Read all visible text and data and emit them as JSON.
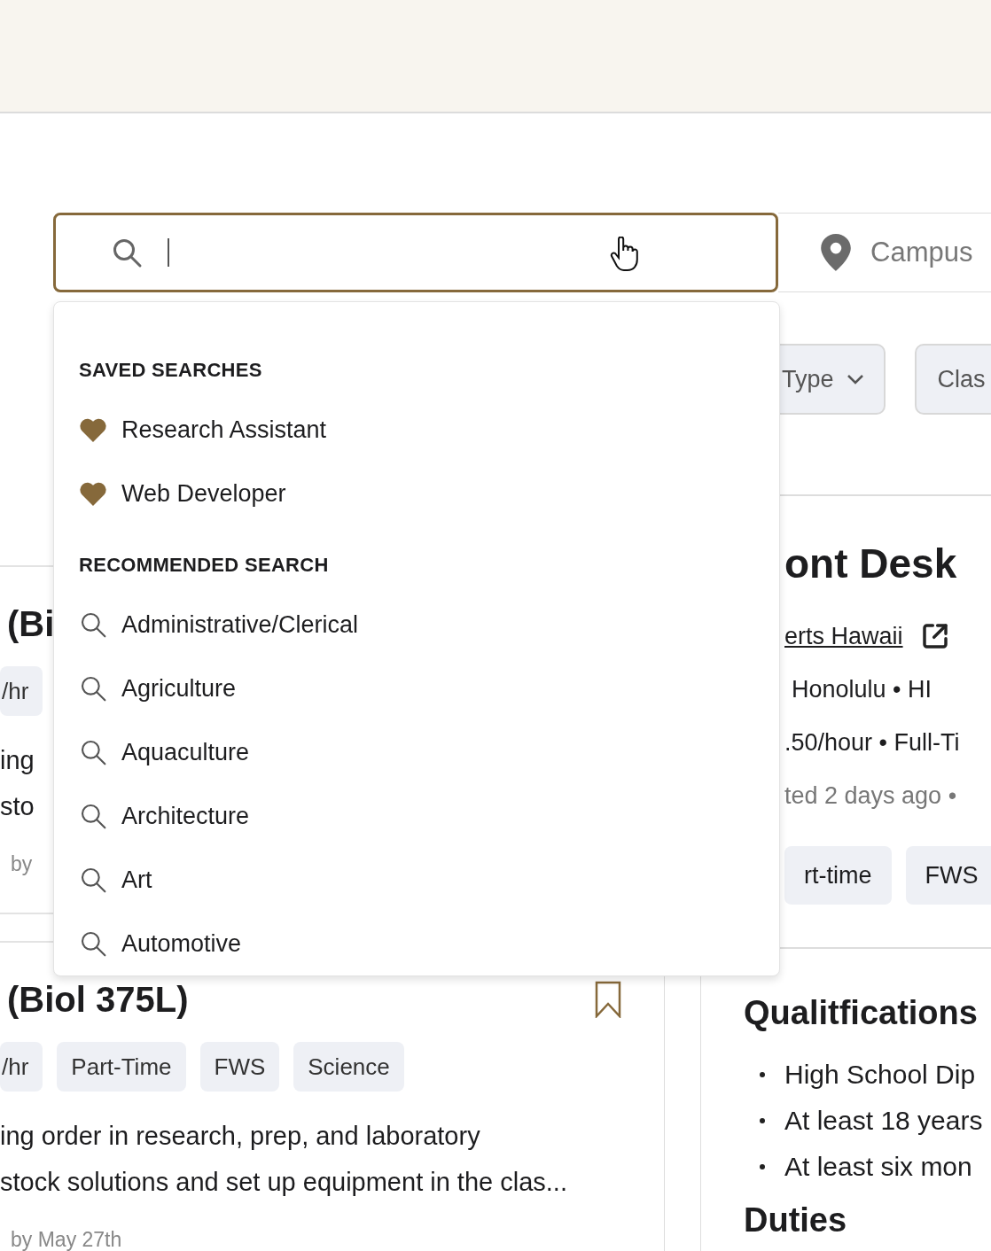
{
  "search": {
    "focused": true
  },
  "location": {
    "placeholder": "Campus"
  },
  "filters": [
    {
      "label": "Type",
      "kind": "dropdown"
    },
    {
      "label": "Clas",
      "kind": "plain"
    }
  ],
  "dropdown": {
    "sections": [
      {
        "heading": "SAVED SEARCHES",
        "kind": "saved",
        "items": [
          "Research Assistant",
          "Web Developer"
        ]
      },
      {
        "heading": "RECOMMENDED SEARCH",
        "kind": "recommended",
        "items": [
          "Administrative/Clerical",
          "Agriculture",
          "Aquaculture",
          "Architecture",
          "Art",
          "Automotive"
        ]
      }
    ]
  },
  "listings": [
    {
      "title": "(Bi",
      "tags": [
        "/hr"
      ],
      "description": "ing\nsto",
      "meta": "by"
    },
    {
      "title": "(Biol 375L)",
      "tags": [
        "/hr",
        "Part-Time",
        "FWS",
        "Science"
      ],
      "description": "ing order in research, prep, and laboratory\nstock solutions and set up equipment in the clas...",
      "meta": "by May 27th",
      "saved": false
    }
  ],
  "detail": {
    "title": "ont Desk",
    "employer": "erts Hawaii",
    "location": "Honolulu • HI",
    "pay": ".50/hour • Full-Ti",
    "posted": "ted 2 days ago •",
    "tags": [
      "rt-time",
      "FWS"
    ],
    "sections": [
      {
        "heading": "Qualitfications",
        "bullets": [
          "High School Dip",
          "At least 18 years",
          "At least six mon"
        ]
      },
      {
        "heading": "Duties"
      }
    ]
  }
}
